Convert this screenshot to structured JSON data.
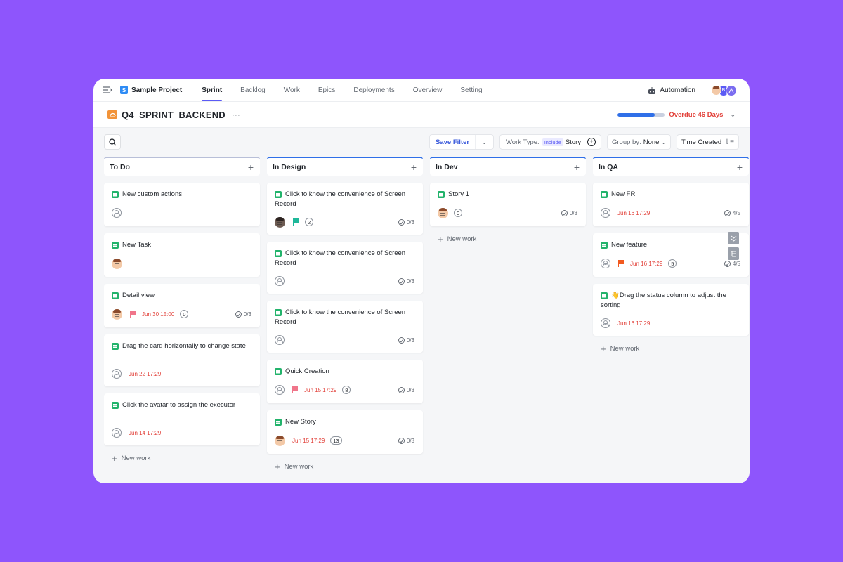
{
  "topnav": {
    "project_name": "Sample Project",
    "project_letter": "S",
    "tabs": [
      "Sprint",
      "Backlog",
      "Work",
      "Epics",
      "Deployments",
      "Overview",
      "Setting"
    ],
    "active_tab": "Sprint",
    "automation_label": "Automation",
    "avatar_initial": "B"
  },
  "sprint": {
    "name": "Q4_SPRINT_BACKEND",
    "more": "···",
    "progress_fraction": 0.78,
    "overdue_label": "Overdue 46 Days"
  },
  "toolbar": {
    "save_filter": "Save Filter",
    "work_type_label": "Work Type:",
    "include_badge": "Include",
    "work_type_value": "Story",
    "group_by_label": "Group by:",
    "group_by_value": "None",
    "sort_label": "Time Created"
  },
  "columns": [
    {
      "title": "To Do",
      "new_work": "New work",
      "cards": [
        {
          "title": "New custom actions",
          "assignee": "empty"
        },
        {
          "title": "New Task",
          "assignee": "face"
        },
        {
          "title": "Detail view",
          "assignee": "face",
          "flag": "pink",
          "due": "Jun 30 15:00",
          "count": "0",
          "subtasks": "0/3"
        },
        {
          "title": "Drag the card horizontally to change state",
          "assignee": "empty",
          "due": "Jun 22 17:29"
        },
        {
          "title": "Click the avatar to assign the executor",
          "assignee": "empty",
          "due": "Jun 14 17:29"
        }
      ]
    },
    {
      "title": "In Design",
      "new_work": "New work",
      "cards": [
        {
          "title": "Click to know the convenience of Screen Record",
          "assignee": "dark",
          "flag": "teal",
          "count": "2",
          "subtasks": "0/3"
        },
        {
          "title": "Click to know the convenience of Screen Record",
          "assignee": "empty",
          "subtasks": "0/3"
        },
        {
          "title": "Click to know the convenience of Screen Record",
          "assignee": "empty",
          "subtasks": "0/3"
        },
        {
          "title": "Quick Creation",
          "assignee": "empty",
          "flag": "pink",
          "due": "Jun 15 17:29",
          "count": "8",
          "subtasks": "0/3"
        },
        {
          "title": "New Story",
          "assignee": "face",
          "due": "Jun 15 17:29",
          "count": "13",
          "subtasks": "0/3"
        }
      ]
    },
    {
      "title": "In Dev",
      "new_work": "New work",
      "cards": [
        {
          "title": "Story 1",
          "assignee": "face",
          "count": "0",
          "subtasks": "0/3"
        }
      ]
    },
    {
      "title": "In QA",
      "new_work": "New work",
      "cards": [
        {
          "title": "New FR",
          "assignee": "empty",
          "due": "Jun 16 17:29",
          "subtasks": "4/5"
        },
        {
          "title": "New feature",
          "assignee": "empty",
          "flag": "orange",
          "due": "Jun 16 17:29",
          "count": "5",
          "subtasks": "4/5"
        },
        {
          "title": "👋Drag the status column to adjust the sorting",
          "assignee": "empty",
          "due": "Jun 16 17:29"
        }
      ]
    }
  ],
  "colors": {
    "background": "#8e55fc",
    "accent": "#5b5bf5",
    "progress": "#2f6fe8",
    "overdue": "#e2413a",
    "story_icon": "#22b36b",
    "flag_pink": "#f0758a",
    "flag_teal": "#1fb89a",
    "flag_orange": "#f25a1f"
  }
}
